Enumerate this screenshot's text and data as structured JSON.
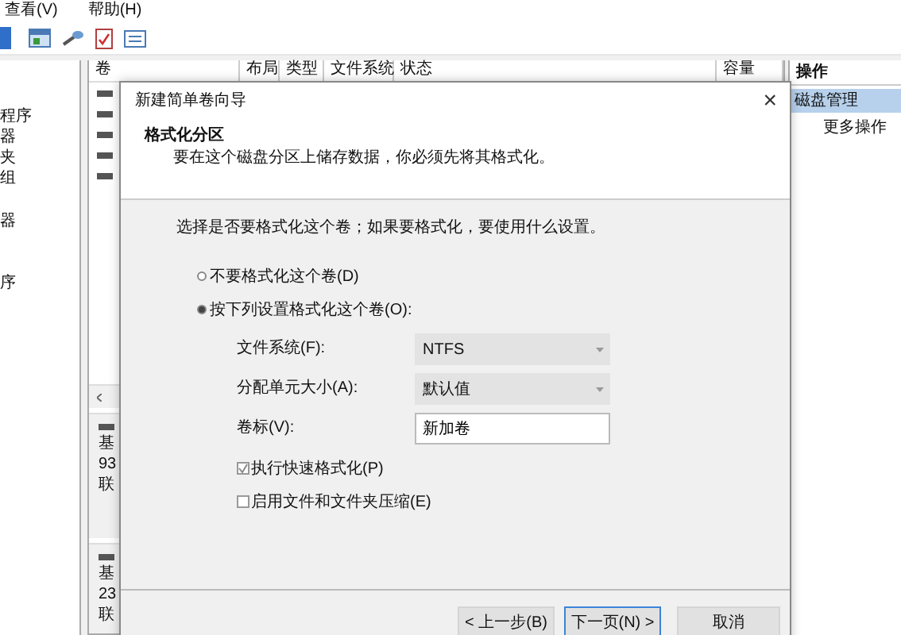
{
  "menu": [
    {
      "label": "查看(V)"
    },
    {
      "label": "帮助(H)"
    }
  ],
  "tree": {
    "items": [
      {
        "label": "程序"
      },
      {
        "label": "器"
      },
      {
        "label": "夹"
      },
      {
        "label": "组"
      },
      {
        "label": "器"
      },
      {
        "label": "序"
      }
    ]
  },
  "volume_table": {
    "columns": [
      "卷",
      "布局",
      "类型",
      "文件系统",
      "状态",
      "容量"
    ]
  },
  "disks": [
    {
      "lines": [
        "基",
        "93",
        "联"
      ]
    },
    {
      "lines": [
        "基",
        "23",
        "联"
      ]
    }
  ],
  "actions": {
    "header": "操作",
    "items": [
      {
        "label": "磁盘管理",
        "selected": true
      },
      {
        "label": "更多操作",
        "selected": false
      }
    ]
  },
  "dialog": {
    "title": "新建简单卷向导",
    "close": "×",
    "header_title": "格式化分区",
    "header_subtitle": "要在这个磁盘分区上储存数据，你必须先将其格式化。",
    "prompt": "选择是否要格式化这个卷；如果要格式化，要使用什么设置。",
    "options": [
      {
        "label": "不要格式化这个卷(D)",
        "selected": false
      },
      {
        "label": "按下列设置格式化这个卷(O):",
        "selected": true
      }
    ],
    "fields": [
      {
        "kind": "dropdown",
        "label": "文件系统(F):",
        "value": "NTFS"
      },
      {
        "kind": "dropdown",
        "label": "分配单元大小(A):",
        "value": "默认值"
      },
      {
        "kind": "text",
        "label": "卷标(V):",
        "value": "新加卷"
      }
    ],
    "checkboxes": [
      {
        "label": "执行快速格式化(P)",
        "checked": true
      },
      {
        "label": "启用文件和文件夹压缩(E)",
        "checked": false
      }
    ],
    "buttons": [
      {
        "label": "< 上一步(B)",
        "focused": false
      },
      {
        "label": "下一页(N) >",
        "focused": true
      },
      {
        "label": "取消",
        "focused": false
      }
    ]
  }
}
